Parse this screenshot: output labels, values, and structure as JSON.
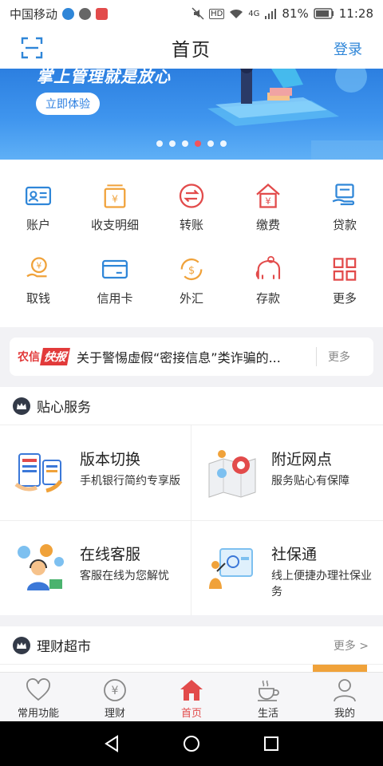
{
  "status_bar": {
    "carrier": "中国移动",
    "battery": "81%",
    "time": "11:28",
    "network": "4G"
  },
  "nav": {
    "title": "首页",
    "login": "登录"
  },
  "banner": {
    "headline": "掌上管理就是放心",
    "button": "立即体验",
    "slide_count": 6,
    "active_slide": 4
  },
  "grid": [
    {
      "label": "账户",
      "icon": "id-card-icon"
    },
    {
      "label": "收支明细",
      "icon": "yuan-book-icon"
    },
    {
      "label": "转账",
      "icon": "transfer-icon"
    },
    {
      "label": "缴费",
      "icon": "yuan-house-icon"
    },
    {
      "label": "贷款",
      "icon": "loan-icon"
    },
    {
      "label": "取钱",
      "icon": "hand-coin-icon"
    },
    {
      "label": "信用卡",
      "icon": "credit-card-icon"
    },
    {
      "label": "外汇",
      "icon": "exchange-icon"
    },
    {
      "label": "存款",
      "icon": "elephant-icon"
    },
    {
      "label": "更多",
      "icon": "more-grid-icon"
    }
  ],
  "news": {
    "tag_a": "农信",
    "tag_b": "快报",
    "text": "关于警惕虚假“密接信息”类诈骗的...",
    "more": "更多"
  },
  "services": {
    "title": "贴心服务",
    "items": [
      {
        "title": "版本切换",
        "desc": "手机银行简约专享版"
      },
      {
        "title": "附近网点",
        "desc": "服务贴心有保障"
      },
      {
        "title": "在线客服",
        "desc": "客服在线为您解忧"
      },
      {
        "title": "社保通",
        "desc": "线上便捷办理社保业务"
      }
    ]
  },
  "finance": {
    "title": "理财超市",
    "more": "更多 >"
  },
  "tabs": [
    {
      "label": "常用功能",
      "icon": "heart-icon",
      "active": false
    },
    {
      "label": "理财",
      "icon": "yuan-circle-icon",
      "active": false
    },
    {
      "label": "首页",
      "icon": "home-icon",
      "active": true
    },
    {
      "label": "生活",
      "icon": "coffee-icon",
      "active": false
    },
    {
      "label": "我的",
      "icon": "user-icon",
      "active": false
    }
  ],
  "colors": {
    "accent": "#2f86d8",
    "red": "#e24b4b",
    "orange": "#f0a23a",
    "banner": "#3f95ee"
  }
}
